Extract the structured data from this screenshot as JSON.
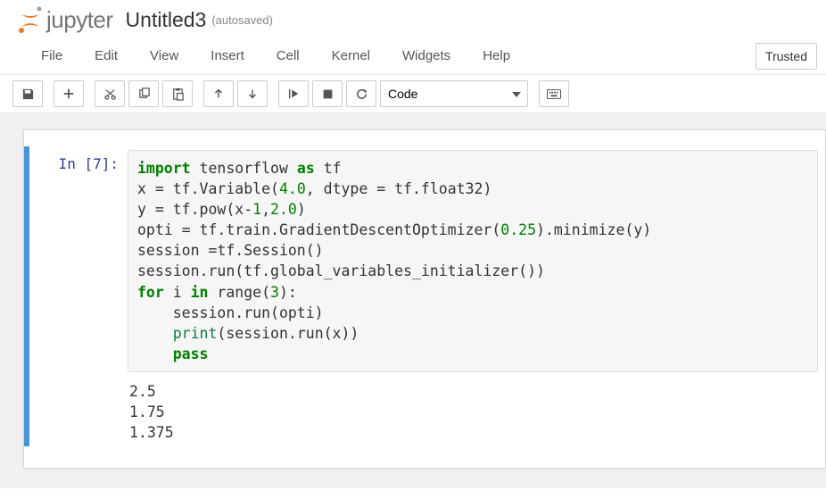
{
  "header": {
    "logo_text": "jupyter",
    "title": "Untitled3",
    "autosave": "(autosaved)"
  },
  "menu": {
    "items": [
      "File",
      "Edit",
      "View",
      "Insert",
      "Cell",
      "Kernel",
      "Widgets",
      "Help"
    ],
    "trusted": "Trusted"
  },
  "toolbar": {
    "cell_type": "Code"
  },
  "cell": {
    "prompt": "In [7]:",
    "code": {
      "l1a": "import",
      "l1b": " tensorflow ",
      "l1c": "as",
      "l1d": " tf",
      "l2a": "x = tf.Variable(",
      "l2b": "4.0",
      "l2c": ", dtype = tf.float32)",
      "l3a": "y = tf.pow(x-",
      "l3b": "1",
      "l3c": ",",
      "l3d": "2.0",
      "l3e": ")",
      "l4a": "opti = tf.train.GradientDescentOptimizer(",
      "l4b": "0.25",
      "l4c": ").minimize(y)",
      "l5": "session =tf.Session()",
      "l6": "session.run(tf.global_variables_initializer())",
      "l7a": "for",
      "l7b": " i ",
      "l7c": "in",
      "l7d": " range(",
      "l7e": "3",
      "l7f": "):",
      "l8": "    session.run(opti)",
      "l9a": "    ",
      "l9b": "print",
      "l9c": "(session.run(x))",
      "l10a": "    ",
      "l10b": "pass"
    },
    "output": "2.5\n1.75\n1.375"
  }
}
